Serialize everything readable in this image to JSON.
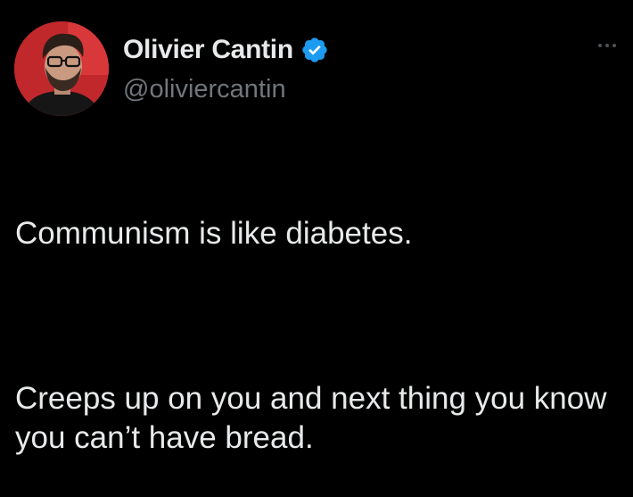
{
  "author": {
    "display_name": "Olivier Cantin",
    "handle": "@oliviercantin",
    "verified": true,
    "verified_color": "#1d9bf0",
    "avatar_bg": "#c0282c"
  },
  "tweet": {
    "paragraph_1": "Communism is like diabetes.",
    "paragraph_2": "Creeps up on you and next thing you know you can’t have bread."
  },
  "icons": {
    "more": "more-horizontal-icon",
    "verified": "verified-badge-icon"
  },
  "colors": {
    "background": "#000000",
    "text_primary": "#e7e9ea",
    "text_secondary": "#71767b"
  }
}
